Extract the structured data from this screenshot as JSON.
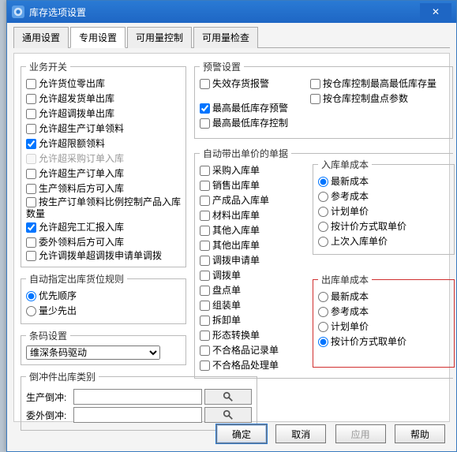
{
  "window": {
    "title": "库存选项设置"
  },
  "tabs": {
    "t0": "通用设置",
    "t1": "专用设置",
    "t2": "可用量控制",
    "t3": "可用量检查",
    "active": 1
  },
  "biz": {
    "legend": "业务开关",
    "c0": {
      "label": "允许货位零出库",
      "checked": false
    },
    "c1": {
      "label": "允许超发货单出库",
      "checked": false
    },
    "c2": {
      "label": "允许超调拨单出库",
      "checked": false
    },
    "c3": {
      "label": "允许超生产订单领料",
      "checked": false
    },
    "c4": {
      "label": "允许超限额领料",
      "checked": true
    },
    "c5": {
      "label": "允许超采购订单入库",
      "checked": false,
      "disabled": true
    },
    "c6": {
      "label": "允许超生产订单入库",
      "checked": false
    },
    "c7": {
      "label": "生产领料后方可入库",
      "checked": false
    },
    "c8": {
      "label": "按生产订单领料比例控制产品入库数量",
      "checked": false
    },
    "c9": {
      "label": "允许超完工汇报入库",
      "checked": true
    },
    "c10": {
      "label": "委外领料后方可入库",
      "checked": false
    },
    "c11": {
      "label": "允许调拨单超调拨申请单调拨",
      "checked": false
    }
  },
  "autoloc": {
    "legend": "自动指定出库货位规则",
    "r0": {
      "label": "优先顺序",
      "checked": true
    },
    "r1": {
      "label": "量少先出",
      "checked": false
    }
  },
  "barcode": {
    "legend": "条码设置",
    "value": "维深条码驱动",
    "options": [
      "维深条码驱动"
    ]
  },
  "offset": {
    "legend": "倒冲件出库类别",
    "row0": {
      "label": "生产倒冲:",
      "value": ""
    },
    "row1": {
      "label": "委外倒冲:",
      "value": ""
    }
  },
  "alert": {
    "legend": "预警设置",
    "a0": {
      "label": "失效存货报警",
      "checked": false
    },
    "a1": {
      "label": "最高最低库存预警",
      "checked": true
    },
    "a2": {
      "label": "最高最低库存控制",
      "checked": false
    }
  },
  "alertR": {
    "b0": {
      "label": "按仓库控制最高最低库存量",
      "checked": false
    },
    "b1": {
      "label": "按仓库控制盘点参数",
      "checked": false
    }
  },
  "bills": {
    "legend": "自动带出单价的单据",
    "d0": {
      "label": "采购入库单",
      "checked": false
    },
    "d1": {
      "label": "销售出库单",
      "checked": false
    },
    "d2": {
      "label": "产成品入库单",
      "checked": false
    },
    "d3": {
      "label": "材料出库单",
      "checked": false
    },
    "d4": {
      "label": "其他入库单",
      "checked": false
    },
    "d5": {
      "label": "其他出库单",
      "checked": false
    },
    "d6": {
      "label": "调拨申请单",
      "checked": false
    },
    "d7": {
      "label": "调拨单",
      "checked": false
    },
    "d8": {
      "label": "盘点单",
      "checked": false
    },
    "d9": {
      "label": "组装单",
      "checked": false
    },
    "d10": {
      "label": "拆卸单",
      "checked": false
    },
    "d11": {
      "label": "形态转换单",
      "checked": false
    },
    "d12": {
      "label": "不合格品记录单",
      "checked": false
    },
    "d13": {
      "label": "不合格品处理单",
      "checked": false
    }
  },
  "incost": {
    "legend": "入库单成本",
    "r0": {
      "label": "最新成本",
      "checked": true
    },
    "r1": {
      "label": "参考成本",
      "checked": false
    },
    "r2": {
      "label": "计划单价",
      "checked": false
    },
    "r3": {
      "label": "按计价方式取单价",
      "checked": false
    },
    "r4": {
      "label": "上次入库单价",
      "checked": false
    }
  },
  "outcost": {
    "legend": "出库单成本",
    "r0": {
      "label": "最新成本",
      "checked": false
    },
    "r1": {
      "label": "参考成本",
      "checked": false
    },
    "r2": {
      "label": "计划单价",
      "checked": false
    },
    "r3": {
      "label": "按计价方式取单价",
      "checked": true
    }
  },
  "buttons": {
    "ok": "确定",
    "cancel": "取消",
    "apply": "应用",
    "help": "帮助"
  }
}
